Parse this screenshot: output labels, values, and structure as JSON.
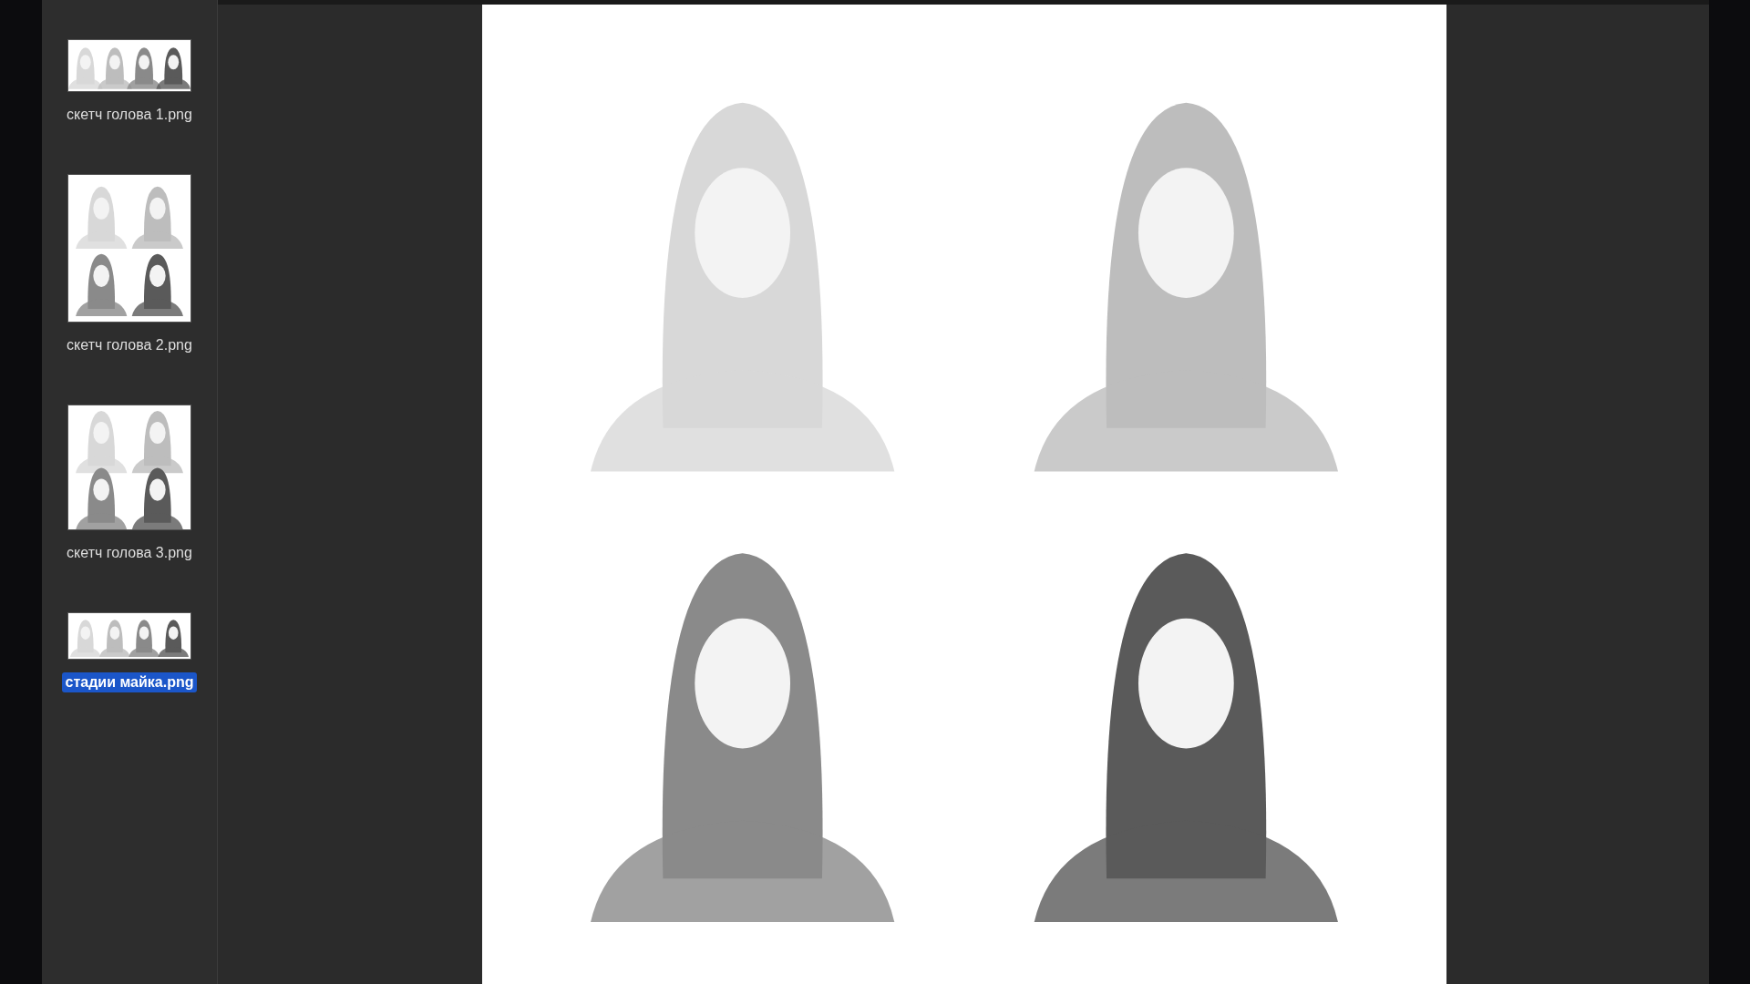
{
  "sidebar": {
    "items": [
      {
        "label": "скетч голова 1.png",
        "selected": false,
        "kind": "row"
      },
      {
        "label": "скетч голова 2.png",
        "selected": false,
        "kind": "grid"
      },
      {
        "label": "скетч голова 3.png",
        "selected": false,
        "kind": "grid"
      },
      {
        "label": "стадии майка.png",
        "selected": true,
        "kind": "row"
      }
    ]
  }
}
